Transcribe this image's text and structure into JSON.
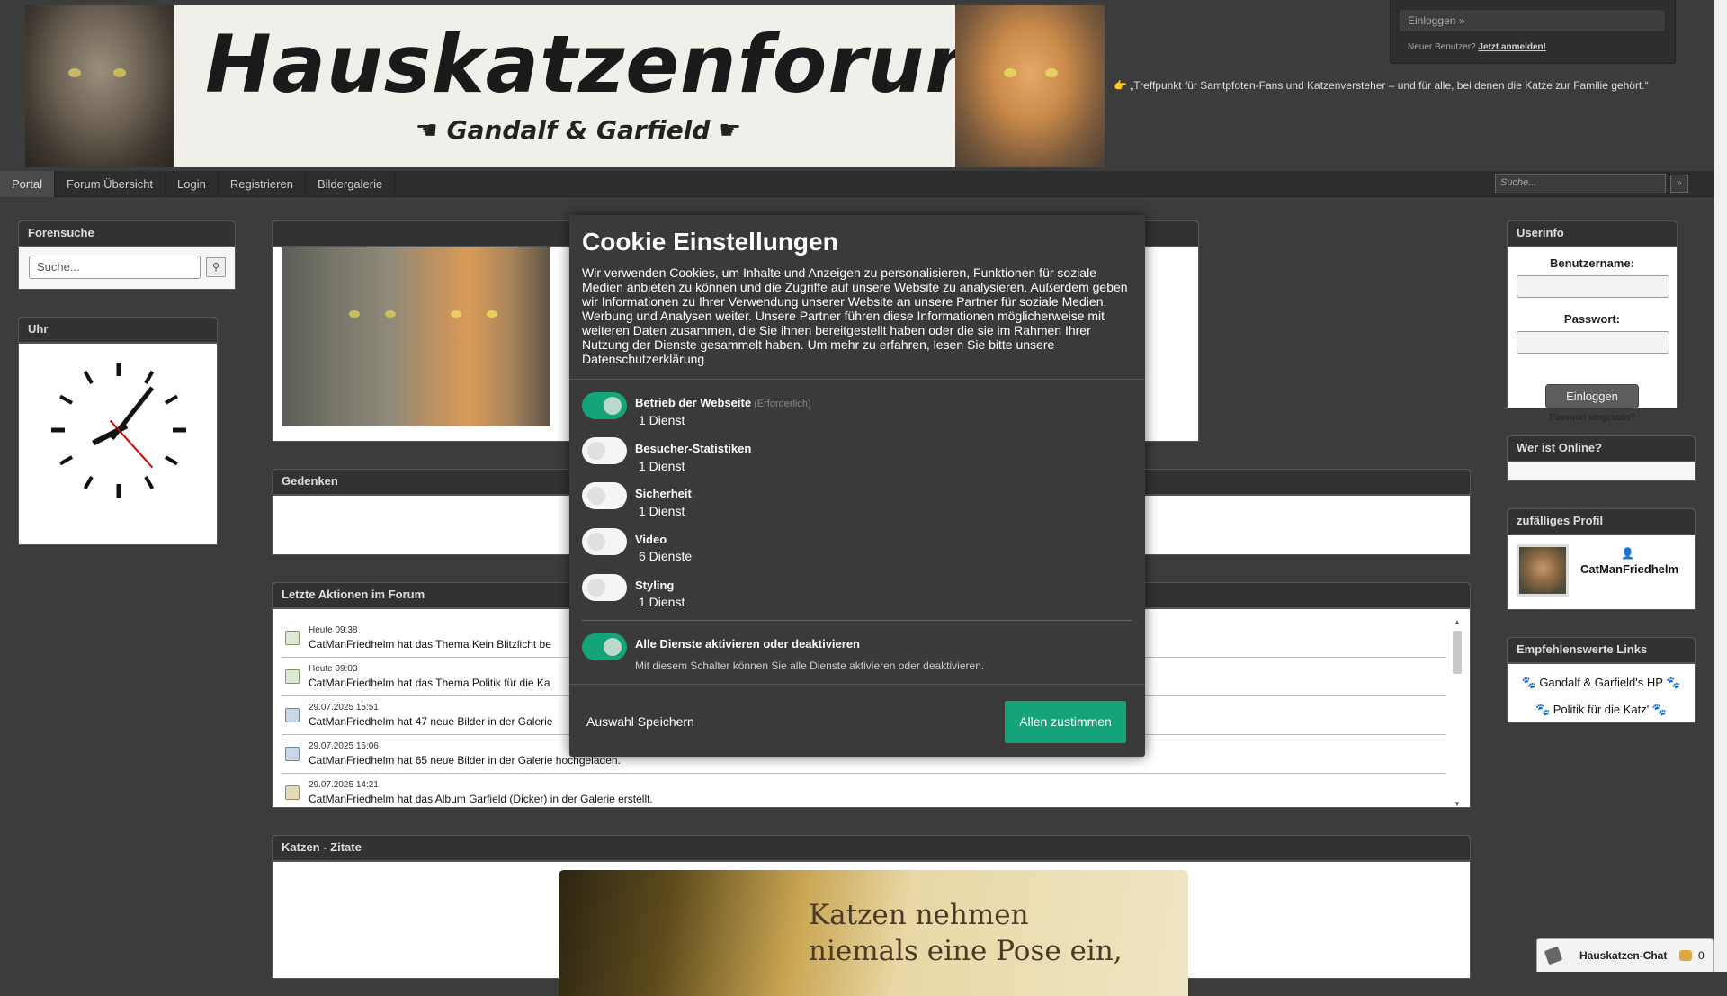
{
  "header": {
    "banner_title": "Hauskatzenforum",
    "banner_subtitle": "☚ Gandalf & Garfield ☛",
    "tagline": "👉 „Treffpunkt für Samtpfoten-Fans und Katzenversteher – und für alle, bei denen die Katze zur Familie gehört.“",
    "login_toggle": "Einloggen »",
    "new_user_prefix": "Neuer Benutzer?",
    "new_user_link": "Jetzt anmelden!"
  },
  "nav": {
    "items": [
      "Portal",
      "Forum Übersicht",
      "Login",
      "Registrieren",
      "Bildergalerie"
    ],
    "search_placeholder": "Suche...",
    "search_button": "»"
  },
  "forensuche": {
    "title": "Forensuche",
    "placeholder": "Suche...",
    "button_icon": "magnifier-icon"
  },
  "uhr": {
    "title": "Uhr",
    "time_display": "08:06:23"
  },
  "gedenken": {
    "title": "Gedenken"
  },
  "actions": {
    "title": "Letzte Aktionen im Forum",
    "items": [
      {
        "date": "Heute 09:38",
        "text": "CatManFriedhelm hat das Thema Kein Blitzlicht be",
        "icon": "doc"
      },
      {
        "date": "Heute 09:03",
        "text": "CatManFriedhelm hat das Thema Politik für die Ka",
        "icon": "doc"
      },
      {
        "date": "29.07.2025 15:51",
        "text": "CatManFriedhelm hat 47 neue Bilder in der Galerie",
        "icon": "img"
      },
      {
        "date": "29.07.2025 15:06",
        "text": "CatManFriedhelm hat 65 neue Bilder in der Galerie hochgeladen.",
        "icon": "img"
      },
      {
        "date": "29.07.2025 14:21",
        "text": "CatManFriedhelm hat das Album Garfield (Dicker) in der Galerie erstellt.",
        "icon": "alb"
      }
    ]
  },
  "zitate": {
    "title": "Katzen - Zitate",
    "quote_line1": "Katzen nehmen",
    "quote_line2": "niemals eine Pose ein,"
  },
  "userinfo": {
    "title": "Userinfo",
    "username_label": "Benutzername:",
    "password_label": "Passwort:",
    "login_button": "Einloggen",
    "forgot_link": "Passwort vergessen?"
  },
  "online": {
    "title": "Wer ist Online?"
  },
  "random_profile": {
    "title": "zufälliges Profil",
    "name": "CatManFriedhelm",
    "icon": "👤"
  },
  "links": {
    "title": "Empfehlenswerte Links",
    "items": [
      "🐾 Gandalf & Garfield's HP 🐾",
      "🐾 Politik für die Katz' 🐾"
    ]
  },
  "cookie": {
    "title": "Cookie Einstellungen",
    "description": "Wir verwenden Cookies, um Inhalte und Anzeigen zu personalisieren, Funktionen für soziale Medien anbieten zu können und die Zugriffe auf unsere Website zu analysieren. Außerdem geben wir Informationen zu Ihrer Verwendung unserer Website an unsere Partner für soziale Medien, Werbung und Analysen weiter. Unsere Partner führen diese Informationen möglicherweise mit weiteren Daten zusammen, die Sie ihnen bereitgestellt haben oder die sie im Rahmen Ihrer Nutzung der Dienste gesammelt haben. Um mehr zu erfahren, lesen Sie bitte unsere Datenschutzerklärung",
    "categories": [
      {
        "name": "Betrieb der Webseite",
        "required": "(Erforderlich)",
        "count": "1 Dienst",
        "on": true
      },
      {
        "name": "Besucher-Statistiken",
        "required": "",
        "count": "1 Dienst",
        "on": false
      },
      {
        "name": "Sicherheit",
        "required": "",
        "count": "1 Dienst",
        "on": false
      },
      {
        "name": "Video",
        "required": "",
        "count": "6 Dienste",
        "on": false
      },
      {
        "name": "Styling",
        "required": "",
        "count": "1 Dienst",
        "on": false
      }
    ],
    "all_label": "Alle Dienste aktivieren oder deaktivieren",
    "all_hint": "Mit diesem Schalter können Sie alle Dienste aktivieren oder deaktivieren.",
    "all_on": true,
    "save_button": "Auswahl Speichern",
    "accept_button": "Allen zustimmen",
    "accent_color": "#15a37a"
  },
  "chat": {
    "label": "Hauskatzen-Chat",
    "count": "0"
  }
}
